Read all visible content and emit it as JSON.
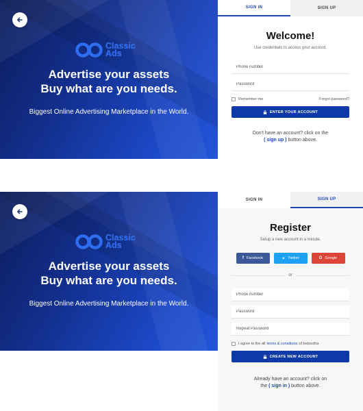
{
  "brand": {
    "line1": "Classic",
    "line2": "Ads"
  },
  "hero": {
    "title_line1": "Advertise your assets",
    "title_line2": "Buy what are you needs.",
    "subtitle": "Biggest Online Advertising Marketplace in the World."
  },
  "tabs": {
    "sign_in": "SIGN IN",
    "sign_up": "SIGN UP"
  },
  "signin": {
    "title": "Welcome!",
    "caption": "Use credentials to access your account.",
    "phone_placeholder": "Phone number",
    "password_placeholder": "Password",
    "remember": "Remember me",
    "forgot": "Forgot password?",
    "submit": "ENTER YOUR ACCOUNT",
    "footer_pre": "Don't have an account? click on the",
    "footer_link": "( sign up )",
    "footer_post": "button above."
  },
  "signup": {
    "title": "Register",
    "caption": "Setup a new account in a minute.",
    "facebook": "Facebook",
    "twitter": "Twitter",
    "google": "Google",
    "or": "or",
    "phone_placeholder": "Phone number",
    "password_placeholder": "Password",
    "repeat_placeholder": "Repeat Password",
    "agree_pre": "I agree to the all",
    "agree_link": "terms & consitions",
    "agree_post": "of bebootha",
    "submit": "CREATE NEW ACCOUNT",
    "footer_pre": "Already have an account? click on",
    "footer_the": "the",
    "footer_link": "( sign in )",
    "footer_post": "button above."
  },
  "colors": {
    "primary": "#0d3aa6",
    "accent": "#1a46b8",
    "facebook": "#3b5998",
    "twitter": "#1da1f2",
    "google": "#db4437"
  },
  "icons": {
    "back": "arrow-left-icon",
    "lock": "lock-icon",
    "logo": "infinity-logo-icon"
  }
}
